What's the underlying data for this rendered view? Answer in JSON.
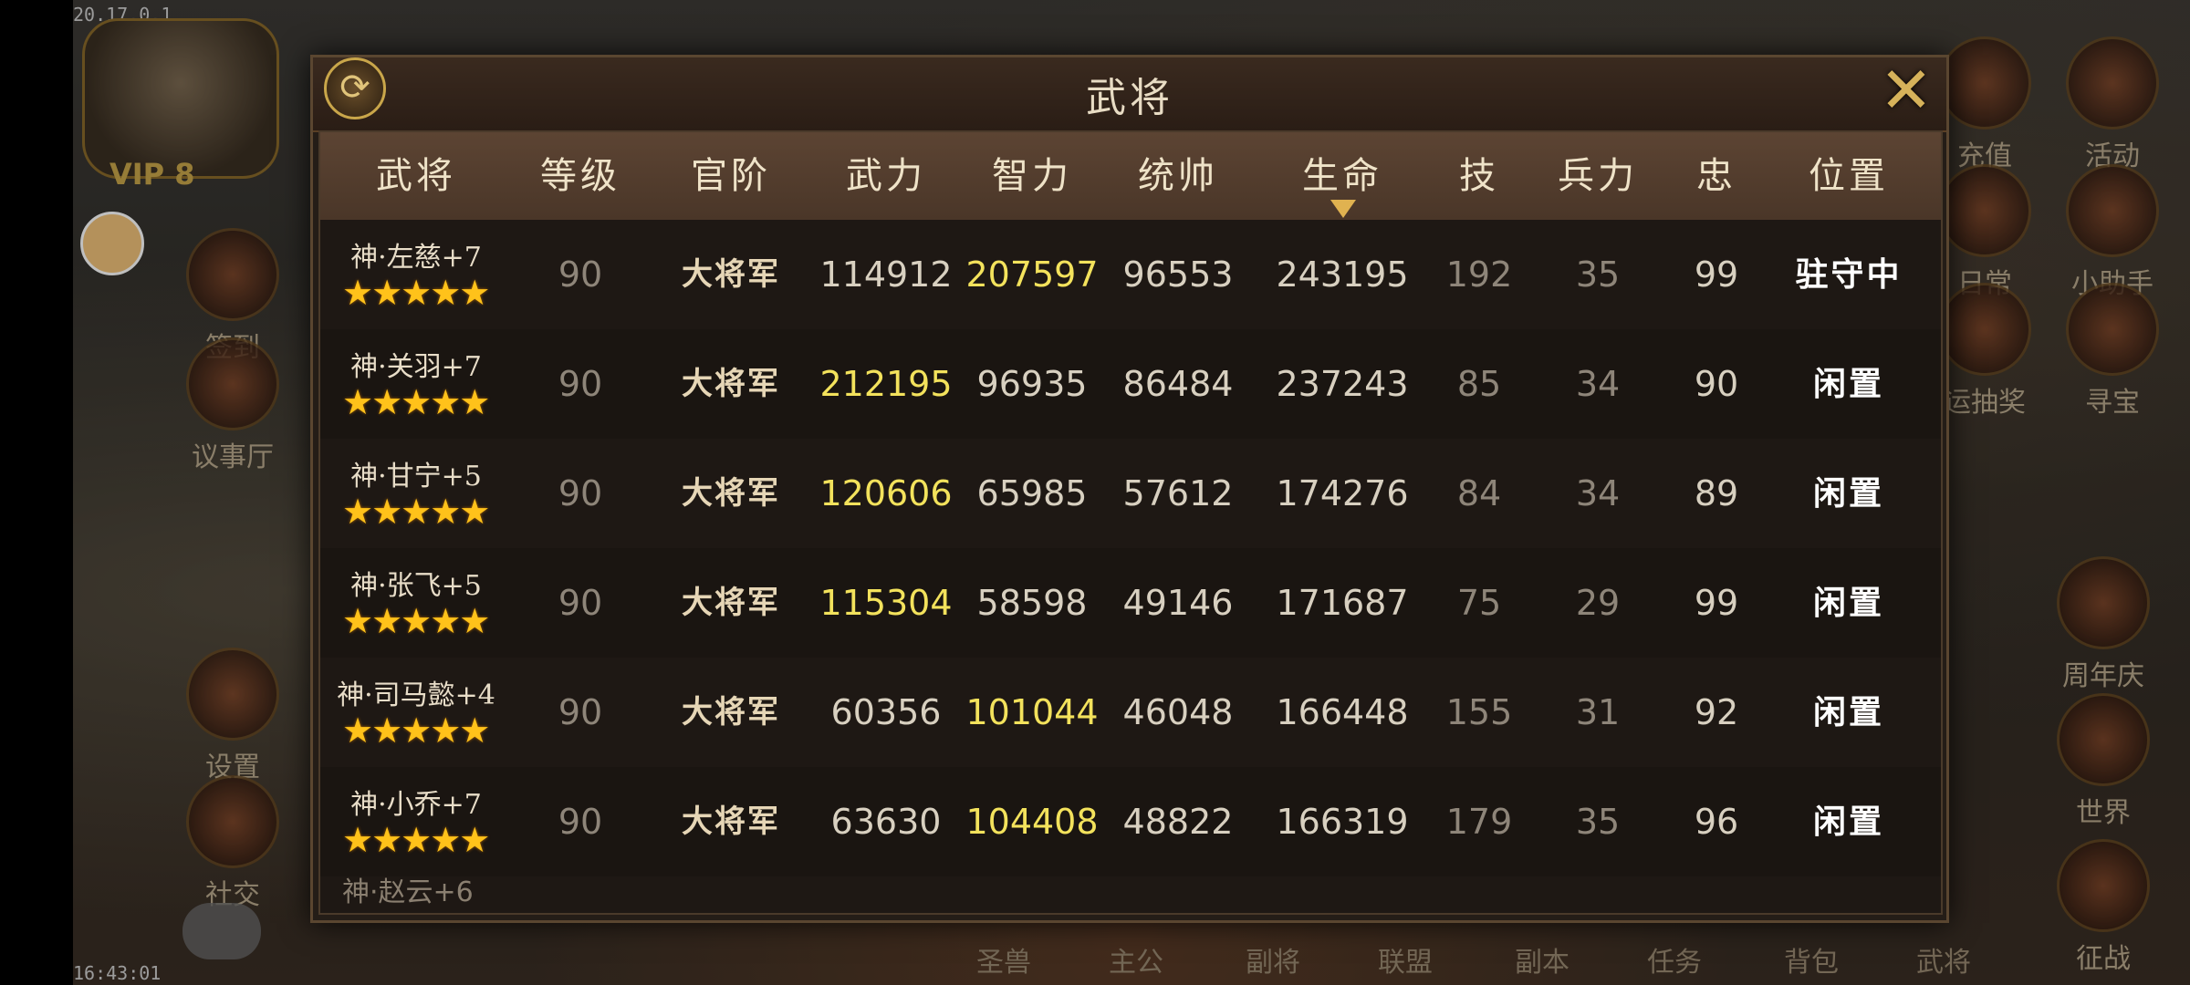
{
  "status": {
    "top_version": "20.17.0.1",
    "bottom_time": "16:43:01"
  },
  "background": {
    "vip": "VIP 8",
    "left_menu": [
      "签到",
      "议事厅",
      "设置",
      "社交"
    ],
    "right_menu": [
      "充值",
      "活动",
      "日常",
      "小助手",
      "运抽奖",
      "寻宝",
      "周年庆",
      "世界",
      "征战"
    ],
    "bottom_nav": [
      "圣兽",
      "主公",
      "副将",
      "联盟",
      "副本",
      "任务",
      "背包",
      "武将"
    ]
  },
  "dialog": {
    "title": "武将",
    "refresh_icon": "refresh-icon",
    "close_icon": "close-x-icon",
    "sort_color": "#e0b250",
    "highlight_color": "#f3e25c",
    "columns": [
      "武将",
      "等级",
      "官阶",
      "武力",
      "智力",
      "统帅",
      "生命",
      "技",
      "兵力",
      "忠",
      "位置"
    ],
    "sorted_column": "生命",
    "rows": [
      {
        "name": "神·左慈+7",
        "stars": 5,
        "level": "90",
        "rank": "大将军",
        "force": "114912",
        "intellect": "207597",
        "command": "96553",
        "hp": "243195",
        "skill": "192",
        "troops": "35",
        "loyalty": "99",
        "position": "驻守中",
        "highlight": "intellect"
      },
      {
        "name": "神·关羽+7",
        "stars": 5,
        "level": "90",
        "rank": "大将军",
        "force": "212195",
        "intellect": "96935",
        "command": "86484",
        "hp": "237243",
        "skill": "85",
        "troops": "34",
        "loyalty": "90",
        "position": "闲置",
        "highlight": "force"
      },
      {
        "name": "神·甘宁+5",
        "stars": 5,
        "level": "90",
        "rank": "大将军",
        "force": "120606",
        "intellect": "65985",
        "command": "57612",
        "hp": "174276",
        "skill": "84",
        "troops": "34",
        "loyalty": "89",
        "position": "闲置",
        "highlight": "force"
      },
      {
        "name": "神·张飞+5",
        "stars": 5,
        "level": "90",
        "rank": "大将军",
        "force": "115304",
        "intellect": "58598",
        "command": "49146",
        "hp": "171687",
        "skill": "75",
        "troops": "29",
        "loyalty": "99",
        "position": "闲置",
        "highlight": "force"
      },
      {
        "name": "神·司马懿+4",
        "stars": 5,
        "level": "90",
        "rank": "大将军",
        "force": "60356",
        "intellect": "101044",
        "command": "46048",
        "hp": "166448",
        "skill": "155",
        "troops": "31",
        "loyalty": "92",
        "position": "闲置",
        "highlight": "intellect"
      },
      {
        "name": "神·小乔+7",
        "stars": 5,
        "level": "90",
        "rank": "大将军",
        "force": "63630",
        "intellect": "104408",
        "command": "48822",
        "hp": "166319",
        "skill": "179",
        "troops": "35",
        "loyalty": "96",
        "position": "闲置",
        "highlight": "intellect"
      }
    ]
  }
}
